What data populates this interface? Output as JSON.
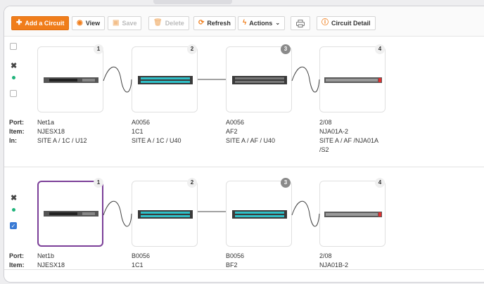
{
  "toolbar": {
    "add_circuit": "Add a Circuit",
    "view": "View",
    "save": "Save",
    "delete": "Delete",
    "refresh": "Refresh",
    "actions": "Actions",
    "circuit_detail": "Circuit Detail"
  },
  "colors": {
    "accent": "#f07d1a",
    "selected_border": "#7b3f98",
    "status_dot": "#1fb37a",
    "checkbox": "#3a7bd5"
  },
  "icons": [
    "plus-icon",
    "eye-icon",
    "save-icon",
    "trash-icon",
    "refresh-icon",
    "lightning-icon",
    "chevron-down-icon",
    "print-icon",
    "info-icon",
    "close-icon"
  ],
  "labels": {
    "port": "Port:",
    "item": "Item:",
    "in": "In:"
  },
  "circuits": [
    {
      "selected": false,
      "nodes": [
        {
          "badge": "1",
          "port": "Net1a",
          "item": "NJESX18",
          "in": "SITE A / 1C / U12"
        },
        {
          "badge": "2",
          "port": "A0056",
          "item": "1C1",
          "in": "SITE A / 1C / U40"
        },
        {
          "badge": "3",
          "port": "A0056",
          "item": "AF2",
          "in": "SITE A / AF / U40"
        },
        {
          "badge": "4",
          "port": "2/08",
          "item": "NJA01A-2",
          "in": "SITE A / AF /NJA01A",
          "in2": "/S2"
        }
      ]
    },
    {
      "selected": true,
      "nodes": [
        {
          "badge": "1",
          "port": "Net1b",
          "item": "NJESX18"
        },
        {
          "badge": "2",
          "port": "B0056",
          "item": "1C1"
        },
        {
          "badge": "3",
          "port": "B0056",
          "item": "BF2"
        },
        {
          "badge": "4",
          "port": "2/08",
          "item": "NJA01B-2"
        }
      ]
    }
  ]
}
